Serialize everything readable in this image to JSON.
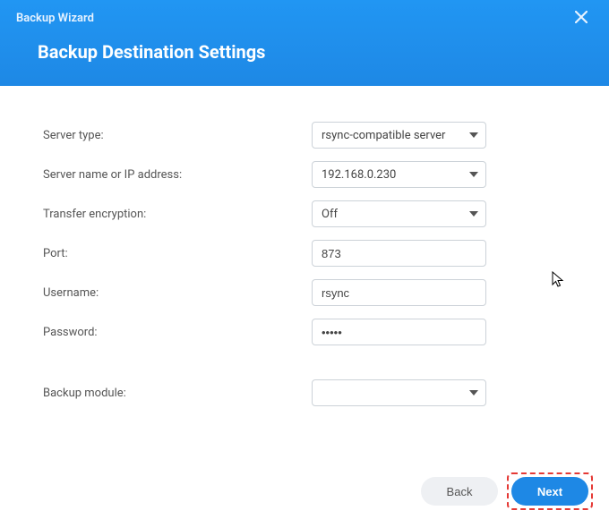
{
  "window_title": "Backup Wizard",
  "page_title": "Backup Destination Settings",
  "fields": {
    "server_type": {
      "label": "Server type:",
      "value": "rsync-compatible server"
    },
    "server_name": {
      "label": "Server name or IP address:",
      "value": "192.168.0.230"
    },
    "encryption": {
      "label": "Transfer encryption:",
      "value": "Off"
    },
    "port": {
      "label": "Port:",
      "value": "873"
    },
    "username": {
      "label": "Username:",
      "value": "rsync"
    },
    "password": {
      "label": "Password:",
      "value": "•••••"
    },
    "backup_module": {
      "label": "Backup module:",
      "value": ""
    }
  },
  "buttons": {
    "back": "Back",
    "next": "Next"
  }
}
